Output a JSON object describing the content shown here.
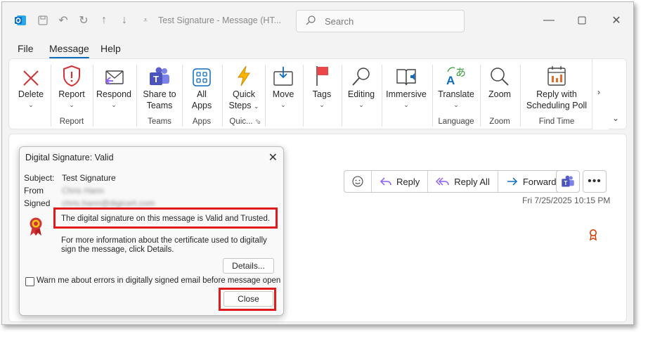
{
  "titlebar": {
    "title": "Test Signature  -  Message (HT...",
    "search_placeholder": "Search"
  },
  "menu_tabs": [
    "File",
    "Message",
    "Help"
  ],
  "ribbon": {
    "buttons": {
      "delete": "Delete",
      "report": "Report",
      "respond": "Respond",
      "share_teams_1": "Share to",
      "share_teams_2": "Teams",
      "all_apps_1": "All",
      "all_apps_2": "Apps",
      "quick_steps_1": "Quick",
      "quick_steps_2": "Steps",
      "move": "Move",
      "tags": "Tags",
      "editing": "Editing",
      "immersive": "Immersive",
      "translate": "Translate",
      "zoom": "Zoom",
      "reply_sched_1": "Reply with",
      "reply_sched_2": "Scheduling Poll"
    },
    "groups": {
      "report": "Report",
      "teams": "Teams",
      "apps": "Apps",
      "quick": "Quic...",
      "language": "Language",
      "zoom": "Zoom",
      "find_time": "Find Time"
    }
  },
  "message": {
    "actions": [
      "Reply",
      "Reply All",
      "Forward"
    ],
    "date": "Fri 7/25/2025 10:15 PM"
  },
  "dialog": {
    "title": "Digital Signature: Valid",
    "subject_label": "Subject:",
    "subject_value": "Test Signature",
    "from_label": "From",
    "from_value": "Chris Hann",
    "signed_label": "Signed",
    "signed_value": "chris.hann@digicert.com",
    "status_text": "The digital signature on this message is Valid and Trusted.",
    "info_text_1": "For more information about the certificate used to digitally",
    "info_text_2": "sign the message, click Details.",
    "details_button": "Details...",
    "checkbox_label": "Warn me about errors in digitally signed email before message open",
    "close_button": "Close"
  },
  "colors": {
    "accent": "#0f6cbd",
    "highlight": "#e01b1b",
    "delete_red": "#d13438",
    "teams_purple": "#5b5fc7"
  }
}
